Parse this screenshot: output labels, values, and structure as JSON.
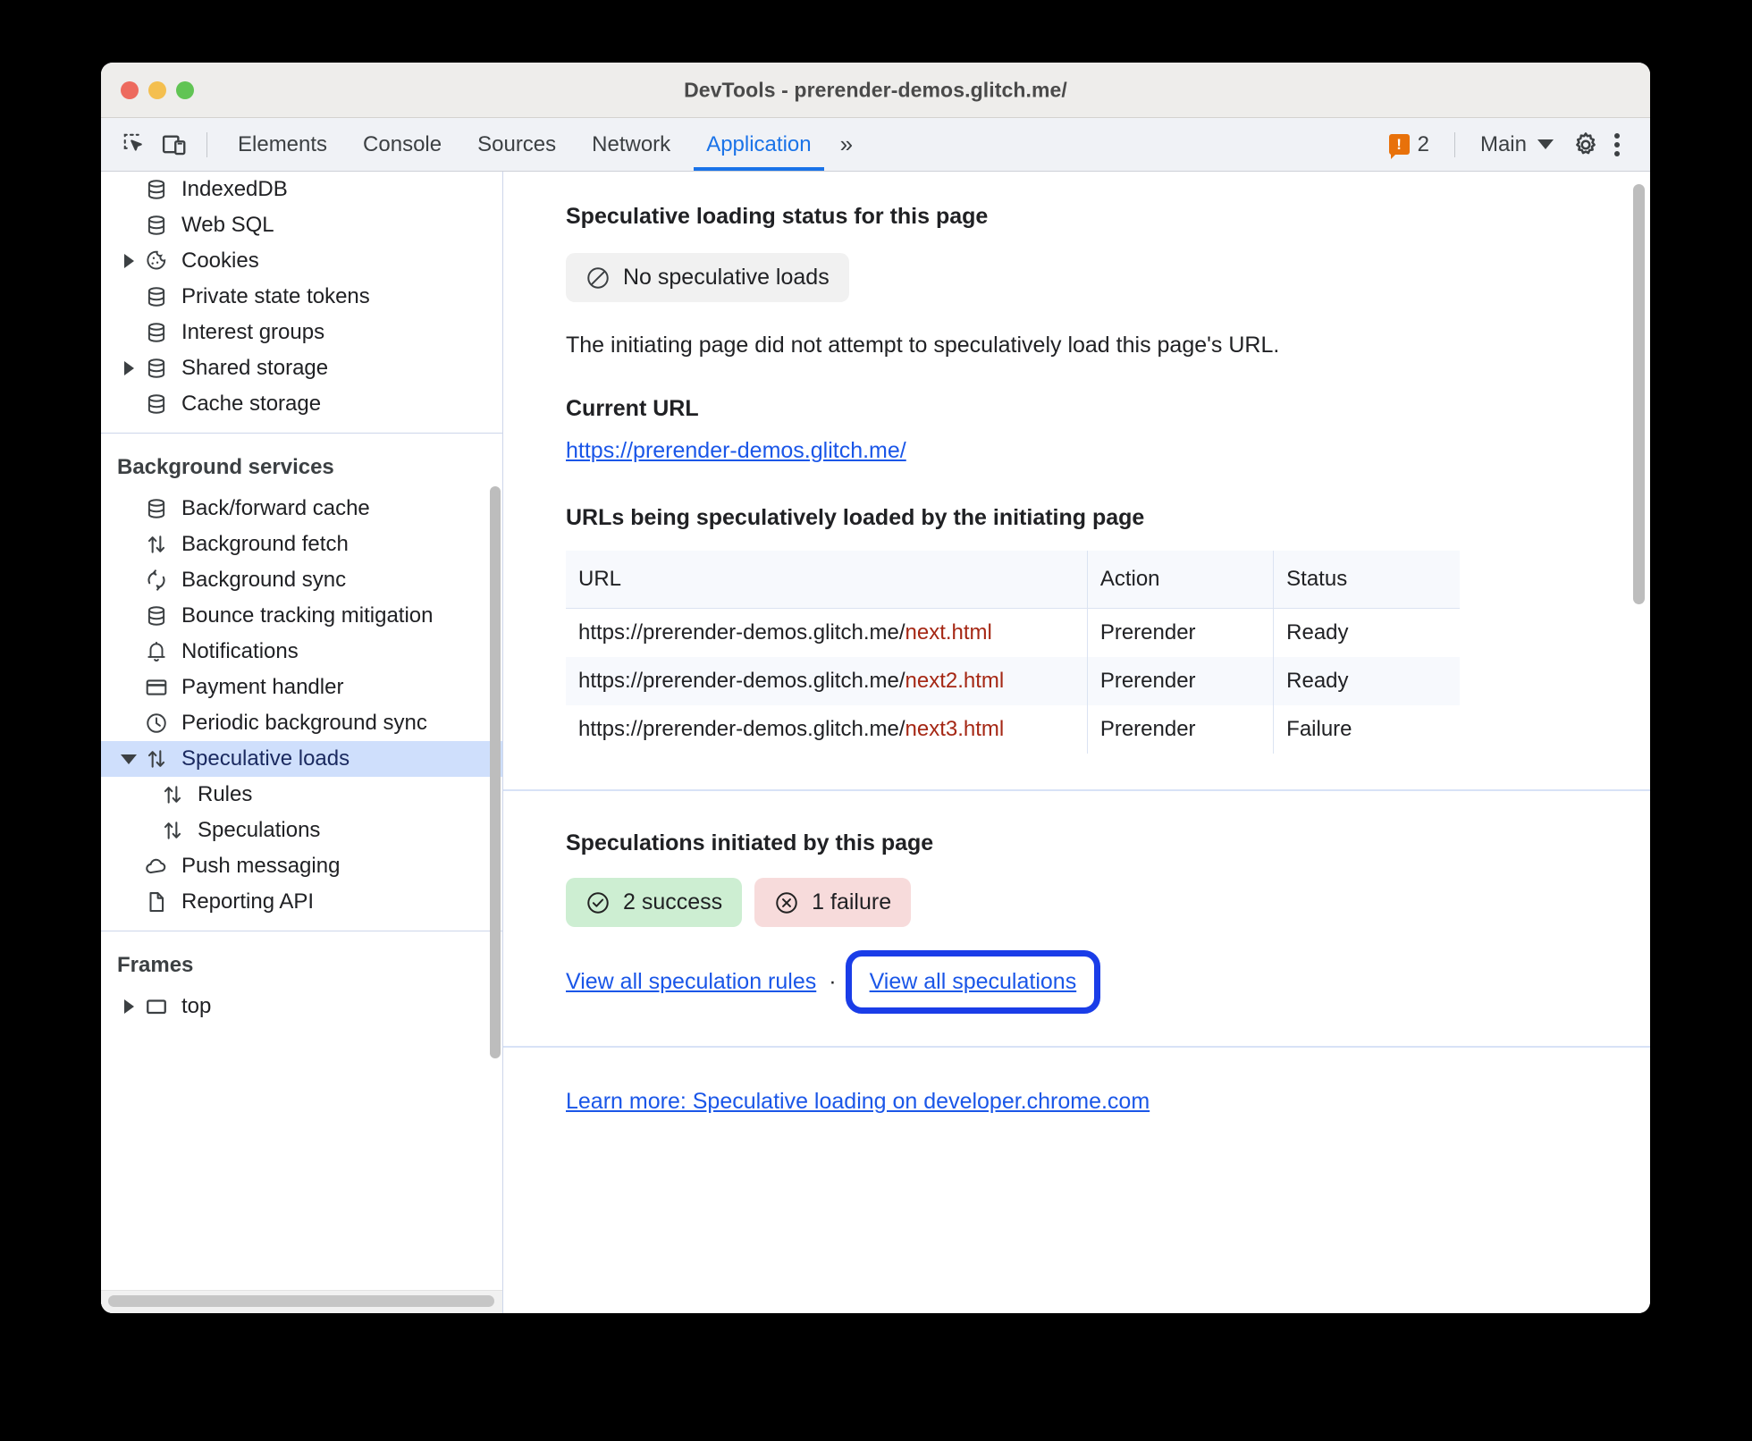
{
  "window": {
    "title": "DevTools - prerender-demos.glitch.me/",
    "traffic_lights": [
      "close",
      "minimize",
      "zoom"
    ]
  },
  "toolbar": {
    "inspect_icon": "inspect-element-icon",
    "device_icon": "device-toolbar-icon",
    "tabs": [
      {
        "label": "Elements",
        "active": false
      },
      {
        "label": "Console",
        "active": false
      },
      {
        "label": "Sources",
        "active": false
      },
      {
        "label": "Network",
        "active": false
      },
      {
        "label": "Application",
        "active": true
      }
    ],
    "more_tabs_label": "»",
    "warning_count": "2",
    "warning_glyph": "!",
    "context_label": "Main",
    "settings_icon": "gear-icon",
    "menu_icon": "kebab-menu-icon",
    "accent_color": "#1a73e8",
    "warning_color": "#e8710a"
  },
  "sidebar": {
    "storage_items": [
      {
        "label": "IndexedDB",
        "icon": "database-icon",
        "twisty": "none",
        "indent": 1
      },
      {
        "label": "Web SQL",
        "icon": "database-icon",
        "twisty": "none",
        "indent": 1
      },
      {
        "label": "Cookies",
        "icon": "cookie-icon",
        "twisty": "collapsed",
        "indent": 1
      },
      {
        "label": "Private state tokens",
        "icon": "database-icon",
        "twisty": "none",
        "indent": 1
      },
      {
        "label": "Interest groups",
        "icon": "database-icon",
        "twisty": "none",
        "indent": 1
      },
      {
        "label": "Shared storage",
        "icon": "database-icon",
        "twisty": "collapsed",
        "indent": 1
      },
      {
        "label": "Cache storage",
        "icon": "database-icon",
        "twisty": "none",
        "indent": 1
      }
    ],
    "background_services": {
      "heading": "Background services",
      "items": [
        {
          "label": "Back/forward cache",
          "icon": "database-icon",
          "twisty": "none",
          "indent": 1,
          "selected": false
        },
        {
          "label": "Background fetch",
          "icon": "updown-arrow-icon",
          "twisty": "none",
          "indent": 1,
          "selected": false
        },
        {
          "label": "Background sync",
          "icon": "sync-icon",
          "twisty": "none",
          "indent": 1,
          "selected": false
        },
        {
          "label": "Bounce tracking mitigation",
          "icon": "database-icon",
          "twisty": "none",
          "indent": 1,
          "selected": false
        },
        {
          "label": "Notifications",
          "icon": "bell-icon",
          "twisty": "none",
          "indent": 1,
          "selected": false
        },
        {
          "label": "Payment handler",
          "icon": "credit-card-icon",
          "twisty": "none",
          "indent": 1,
          "selected": false
        },
        {
          "label": "Periodic background sync",
          "icon": "clock-icon",
          "twisty": "none",
          "indent": 1,
          "selected": false
        },
        {
          "label": "Speculative loads",
          "icon": "updown-arrow-icon",
          "twisty": "expanded",
          "indent": 1,
          "selected": true
        },
        {
          "label": "Rules",
          "icon": "updown-arrow-icon",
          "twisty": "none",
          "indent": 2,
          "selected": false
        },
        {
          "label": "Speculations",
          "icon": "updown-arrow-icon",
          "twisty": "none",
          "indent": 2,
          "selected": false
        },
        {
          "label": "Push messaging",
          "icon": "cloud-icon",
          "twisty": "none",
          "indent": 1,
          "selected": false
        },
        {
          "label": "Reporting API",
          "icon": "document-icon",
          "twisty": "none",
          "indent": 1,
          "selected": false
        }
      ]
    },
    "frames": {
      "heading": "Frames",
      "items": [
        {
          "label": "top",
          "icon": "frame-icon",
          "twisty": "collapsed",
          "indent": 1,
          "selected": false
        }
      ]
    },
    "selection_color": "#cfdffc"
  },
  "main": {
    "status_section": {
      "title": "Speculative loading status for this page",
      "chip": {
        "label": "No speculative loads",
        "icon": "no-entry-icon"
      },
      "description": "The initiating page did not attempt to speculatively load this page's URL."
    },
    "current_url_section": {
      "title": "Current URL",
      "url": "https://prerender-demos.glitch.me/"
    },
    "urls_table_section": {
      "title": "URLs being speculatively loaded by the initiating page",
      "columns": [
        "URL",
        "Action",
        "Status"
      ],
      "rows": [
        {
          "url_base": "https://prerender-demos.glitch.me/",
          "url_tail": "next.html",
          "action": "Prerender",
          "status": "Ready"
        },
        {
          "url_base": "https://prerender-demos.glitch.me/",
          "url_tail": "next2.html",
          "action": "Prerender",
          "status": "Ready"
        },
        {
          "url_base": "https://prerender-demos.glitch.me/",
          "url_tail": "next3.html",
          "action": "Prerender",
          "status": "Failure"
        }
      ]
    },
    "speculations_section": {
      "title": "Speculations initiated by this page",
      "success_chip": {
        "label": "2 success",
        "icon": "check-circle-icon",
        "color": "#cdeed2"
      },
      "failure_chip": {
        "label": "1 failure",
        "icon": "x-circle-icon",
        "color": "#f7dbdb"
      },
      "links": {
        "rules_link": "View all speculation rules",
        "separator": "·",
        "speculations_link": "View all speculations",
        "highlight_color": "#1a3de8"
      }
    },
    "footer": {
      "learn_more_link": "Learn more: Speculative loading on developer.chrome.com"
    },
    "link_color": "#1a56e8",
    "url_tail_color": "#a52714"
  }
}
